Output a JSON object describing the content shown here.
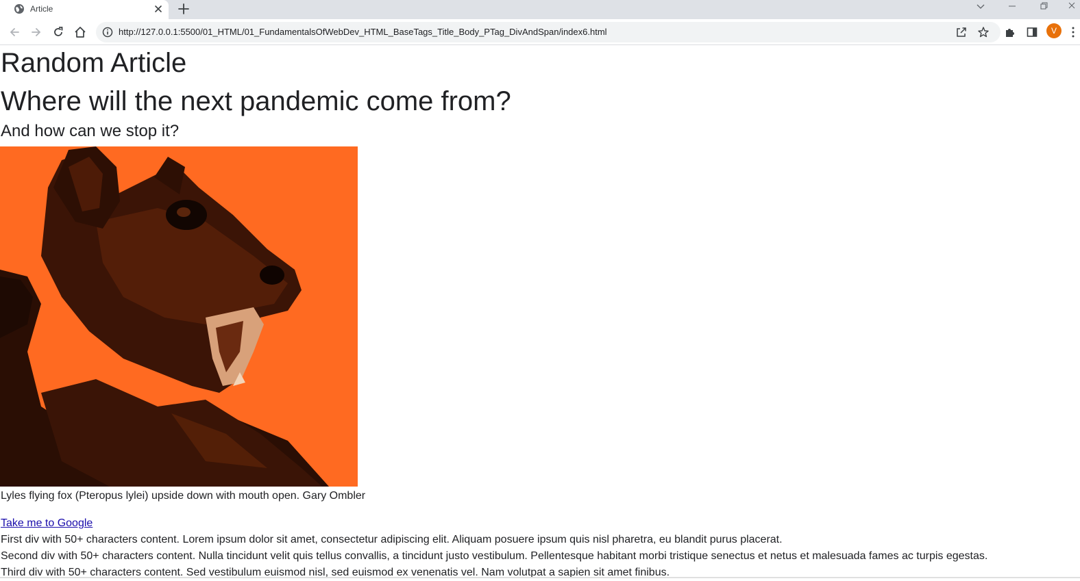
{
  "browser": {
    "tab": {
      "title": "Article",
      "favicon": "globe-icon"
    },
    "url": "http://127.0.0.1:5500/01_HTML/01_FundamentalsOfWebDev_HTML_BaseTags_Title_Body_PTag_DivAndSpan/index6.html",
    "profile_initial": "V",
    "profile_color": "#e8710a"
  },
  "article": {
    "site_title": "Random Article",
    "headline": "Where will the next pandemic come from?",
    "subheadline": "And how can we stop it?",
    "image": {
      "subject": "bat-photo",
      "tint": "#ff6a21"
    },
    "caption": "Lyles flying fox (Pteropus lylei) upside down with mouth open. Gary Ombler",
    "link_text": "Take me to Google",
    "paragraphs": [
      "First div with 50+ characters content. Lorem ipsum dolor sit amet, consectetur adipiscing elit. Aliquam posuere ipsum quis nisl pharetra, eu blandit purus placerat.",
      "Second div with 50+ characters content. Nulla tincidunt velit quis tellus convallis, a tincidunt justo vestibulum. Pellentesque habitant morbi tristique senectus et netus et malesuada fames ac turpis egestas.",
      "Third div with 50+ characters content. Sed vestibulum euismod nisl, sed euismod ex venenatis vel. Nam volutpat a sapien sit amet finibus."
    ]
  }
}
